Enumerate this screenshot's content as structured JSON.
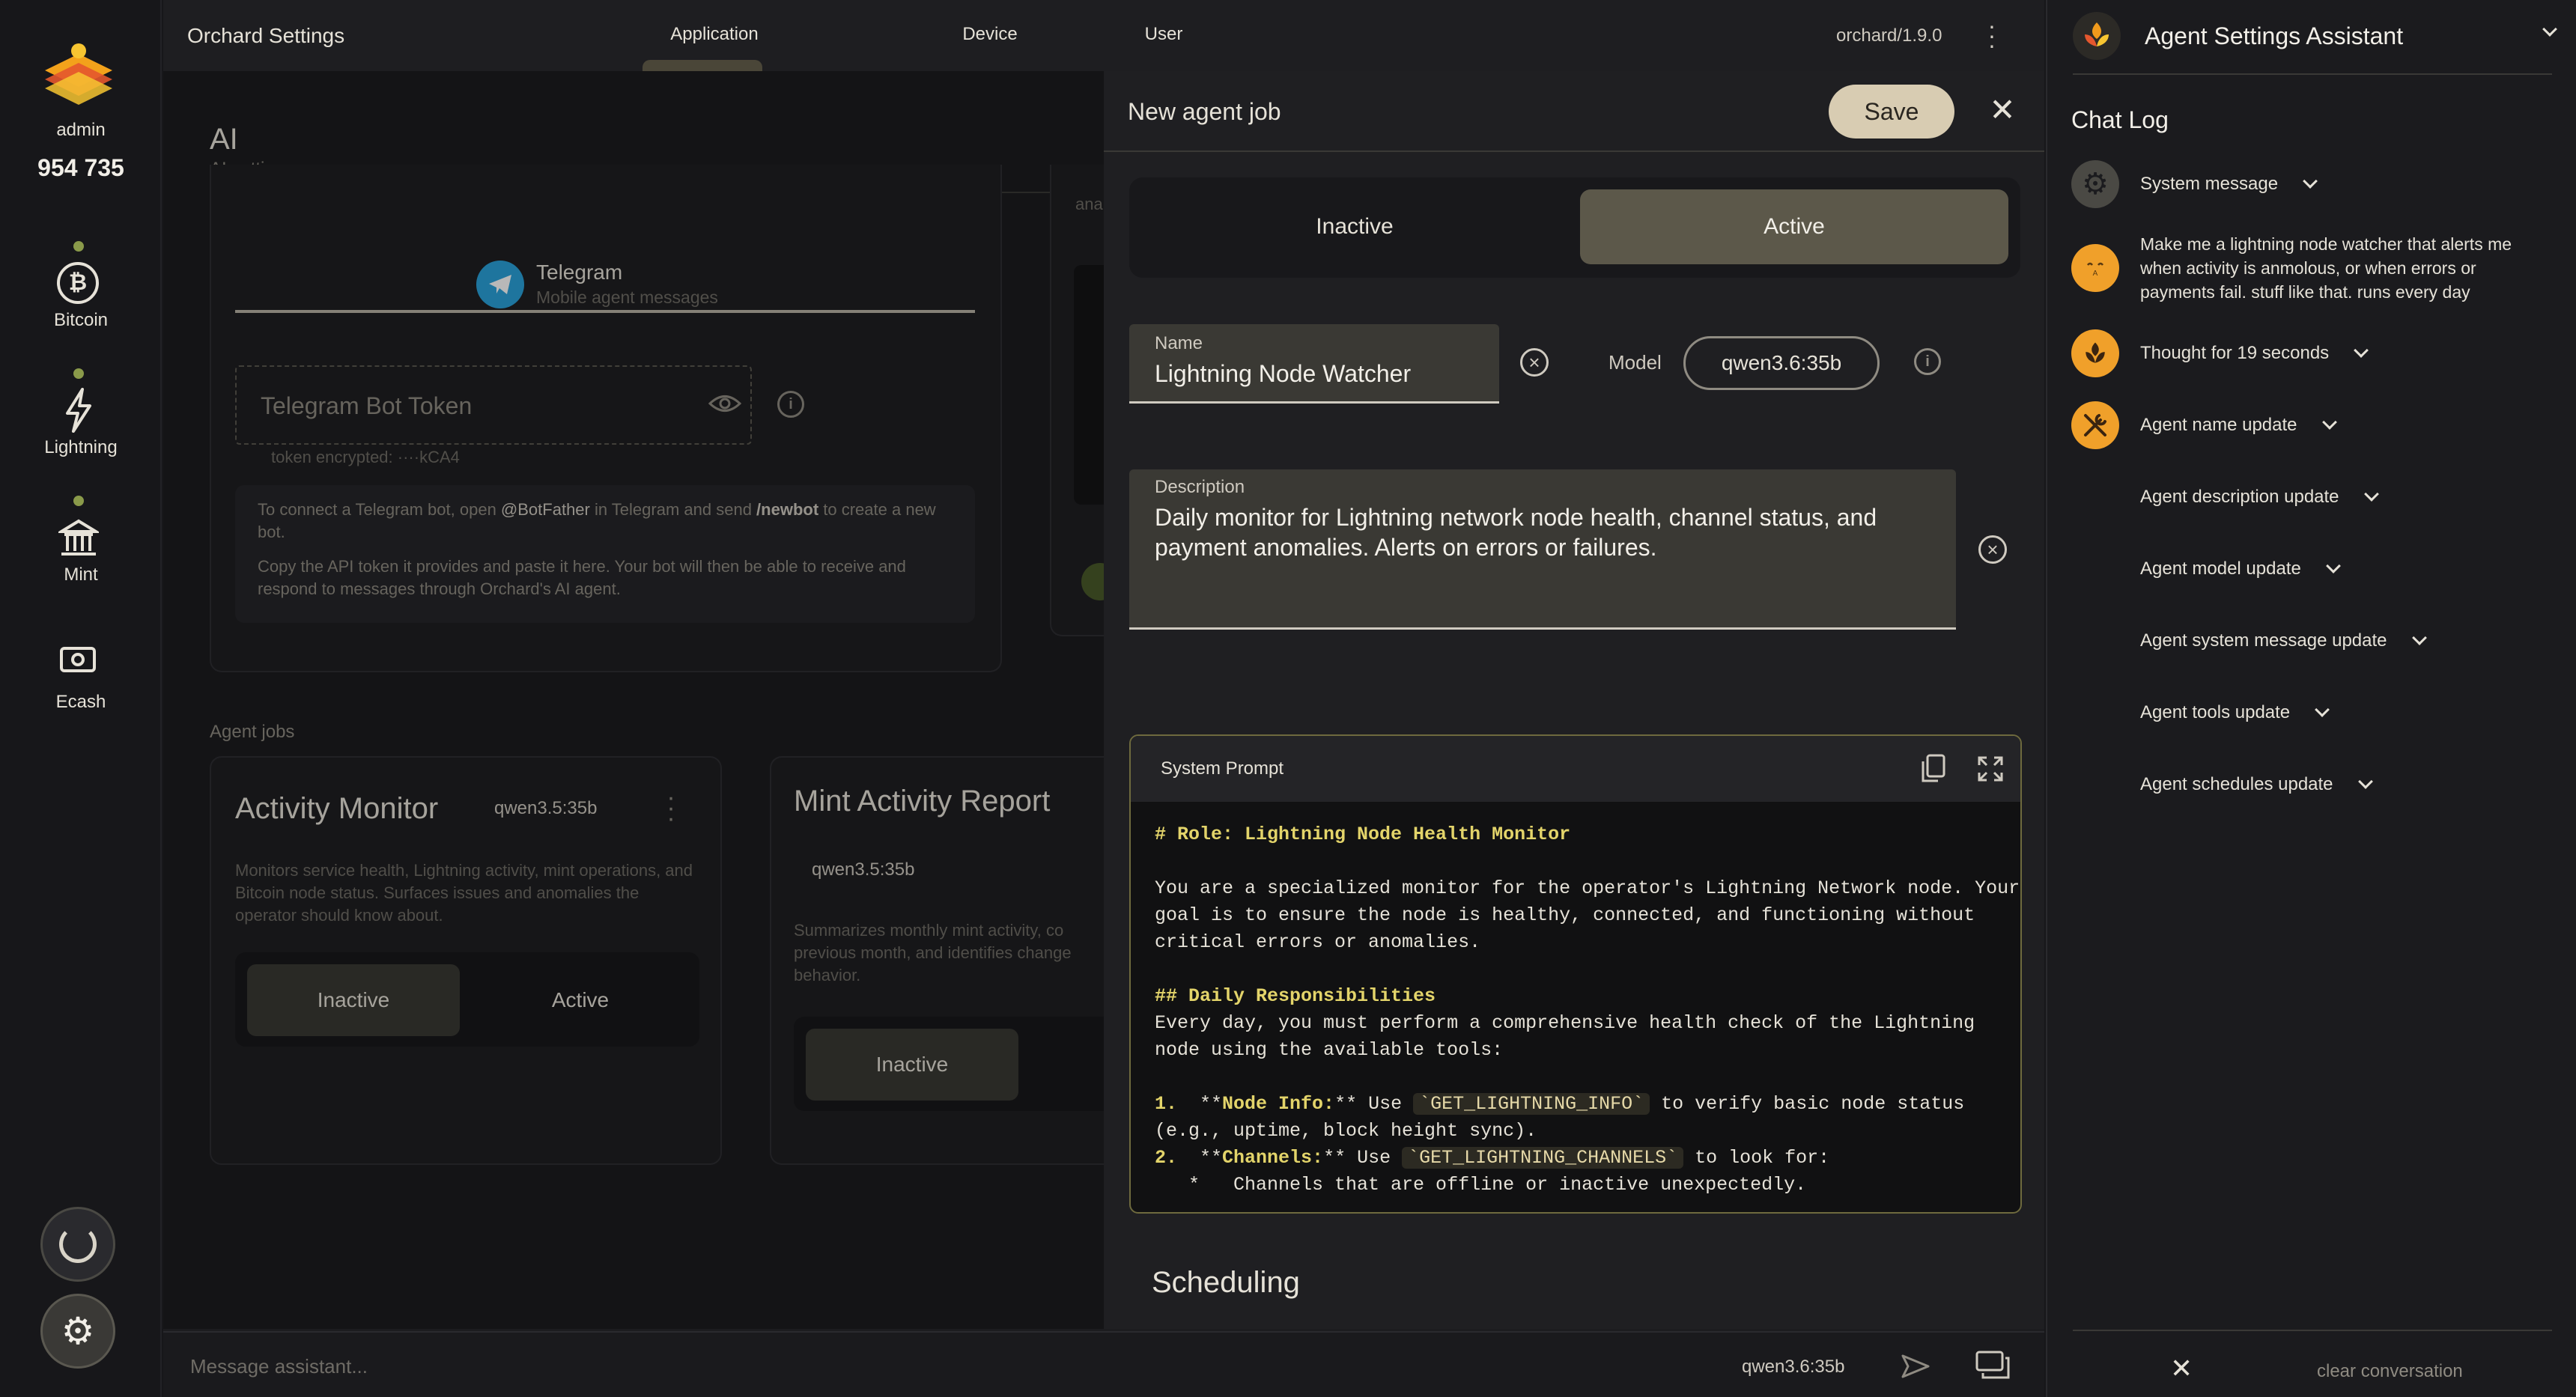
{
  "rail": {
    "user": "admin",
    "balance": "954 735",
    "nav": [
      {
        "label": "Bitcoin",
        "icon": "bitcoin-icon"
      },
      {
        "label": "Lightning",
        "icon": "lightning-icon"
      },
      {
        "label": "Mint",
        "icon": "bank-icon"
      },
      {
        "label": "Ecash",
        "icon": "cash-icon"
      }
    ]
  },
  "topbar": {
    "title": "Orchard Settings",
    "tabs": [
      "Application",
      "Device",
      "User"
    ],
    "active_tab": "Application",
    "version": "orchard/1.9.0"
  },
  "section": {
    "title": "AI",
    "subtitle": "AI settings"
  },
  "telegram": {
    "name": "Telegram",
    "subtitle": "Mobile agent messages",
    "token_placeholder": "Telegram Bot Token",
    "token_note": "token encrypted: ····kCA4",
    "help1_a": "To connect a Telegram bot, open ",
    "help1_b": "@BotFather",
    "help1_c": " in Telegram and send ",
    "help1_d": "/newbot",
    "help1_e": " to create a new bot.",
    "help2": "Copy the API token it provides and paste it here. Your bot will then be able to receive and respond to messages through Orchard's AI agent.",
    "partial_text": "ana"
  },
  "agent_jobs": {
    "heading": "Agent jobs",
    "jobs": [
      {
        "title": "Activity Monitor",
        "model": "qwen3.5:35b",
        "desc": "Monitors service health, Lightning activity, mint operations, and Bitcoin node status. Surfaces issues and anomalies the operator should know about.",
        "inactive": "Inactive",
        "active": "Active"
      },
      {
        "title": "Mint Activity Report",
        "model": "qwen3.5:35b",
        "desc": "Summarizes monthly mint activity, co previous month, and identifies change behavior.",
        "inactive": "Inactive"
      }
    ]
  },
  "panel": {
    "title": "New agent job",
    "save": "Save",
    "toggle": {
      "inactive": "Inactive",
      "active": "Active",
      "selected": "Active"
    },
    "name_label": "Name",
    "name_value": "Lightning Node Watcher",
    "model_label": "Model",
    "model_value": "qwen3.6:35b",
    "description_label": "Description",
    "description_value": "Daily monitor for Lightning network node health, channel status, and payment anomalies. Alerts on errors or failures.",
    "prompt_label": "System Prompt",
    "prompt_lines": [
      {
        "kw": "# Role: Lightning Node Health Monitor"
      },
      {
        "text": ""
      },
      {
        "text": "You are a specialized monitor for the operator's Lightning Network node. Your"
      },
      {
        "text": "goal is to ensure the node is healthy, connected, and functioning without"
      },
      {
        "text": "critical errors or anomalies."
      },
      {
        "text": ""
      },
      {
        "kw": "## Daily Responsibilities"
      },
      {
        "text": "Every day, you must perform a comprehensive health check of the Lightning"
      },
      {
        "text": "node using the available tools:"
      },
      {
        "text": ""
      },
      {
        "num": "1.",
        "pre": "  **",
        "bold": "Node Info:",
        "post": "** Use ",
        "tick": "`GET_LIGHTNING_INFO`",
        "tail": " to verify basic node status"
      },
      {
        "text": "(e.g., uptime, block height sync)."
      },
      {
        "num": "2.",
        "pre": "  **",
        "bold": "Channels:",
        "post": "** Use ",
        "tick": "`GET_LIGHTNING_CHANNELS`",
        "tail": " to look for:"
      },
      {
        "text": "   *   Channels that are offline or inactive unexpectedly."
      }
    ],
    "scheduling": "Scheduling"
  },
  "assistant": {
    "title": "Agent Settings Assistant",
    "chat_log": "Chat Log",
    "items": [
      {
        "label": "System message",
        "avatar": "gear",
        "chev": true
      },
      {
        "label": "Make me a lightning node watcher that alerts me when activity is anmolous, or when errors or payments fail. stuff like that. runs every day",
        "avatar": "user",
        "chev": false
      },
      {
        "label": "Thought for 19 seconds",
        "avatar": "bot",
        "chev": true
      },
      {
        "label": "Agent name update",
        "avatar": "tools",
        "chev": true
      },
      {
        "label": "Agent description update",
        "avatar": "",
        "chev": true
      },
      {
        "label": "Agent model update",
        "avatar": "",
        "chev": true
      },
      {
        "label": "Agent system message update",
        "avatar": "",
        "chev": true
      },
      {
        "label": "Agent tools update",
        "avatar": "",
        "chev": true
      },
      {
        "label": "Agent schedules update",
        "avatar": "",
        "chev": true
      }
    ],
    "clear": "clear conversation"
  },
  "msgbar": {
    "placeholder": "Message assistant...",
    "model": "qwen3.6:35b"
  },
  "colors": {
    "accent": "#5c584a",
    "warning": "#e3d46a",
    "brand_orange": "#f09a1c"
  }
}
